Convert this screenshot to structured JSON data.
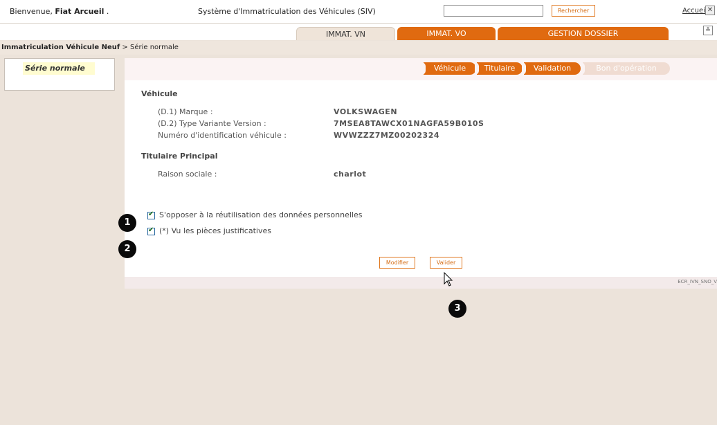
{
  "header": {
    "welcome_prefix": "Bienvenue,",
    "user_name": "Fiat Arcueil",
    "welcome_suffix": ".",
    "system_title": "Système d'Immatriculation des Véhicules (SIV)",
    "search_value": "",
    "search_button": "Rechercher",
    "home_link": "Accueil",
    "close_glyph": "✕"
  },
  "tabs": [
    {
      "label": "IMMAT. VN",
      "active": true
    },
    {
      "label": "IMMAT. VO",
      "active": false
    },
    {
      "label": "GESTION DOSSIER",
      "active": false
    }
  ],
  "collapse_glyph": "≚",
  "breadcrumb": {
    "root": "Immatriculation Véhicule Neuf",
    "separator": ">",
    "current": "Série normale"
  },
  "sidebar": {
    "items": [
      {
        "label": "Série normale",
        "selected": true
      }
    ]
  },
  "steps": [
    {
      "label": "Véhicule",
      "state": "done"
    },
    {
      "label": "Titulaire",
      "state": "done"
    },
    {
      "label": "Validation",
      "state": "current"
    },
    {
      "label": "Bon d'opération",
      "state": "disabled"
    }
  ],
  "vehicle": {
    "section_title": "Véhicule",
    "fields": [
      {
        "label": "(D.1) Marque :",
        "value": "VOLKSWAGEN"
      },
      {
        "label": "(D.2) Type Variante Version :",
        "value": "7MSEA8TAWCX01NAGFA59B010S"
      },
      {
        "label": "Numéro d'identification véhicule :",
        "value": "WVWZZZ7MZ00202324"
      }
    ]
  },
  "holder": {
    "section_title": "Titulaire Principal",
    "fields": [
      {
        "label": "Raison sociale :",
        "value": "charlot"
      }
    ]
  },
  "checkboxes": [
    {
      "label": "S'opposer à la réutilisation des données personnelles",
      "checked": true
    },
    {
      "label": "(*) Vu les pièces justificatives",
      "checked": true
    }
  ],
  "buttons": {
    "modify": "Modifier",
    "validate": "Valider"
  },
  "screen_code": "ECR_IVN_SNO_V",
  "markers": [
    "1",
    "2",
    "3"
  ],
  "colors": {
    "accent": "#e06a10",
    "page_bg": "#ece3da"
  }
}
